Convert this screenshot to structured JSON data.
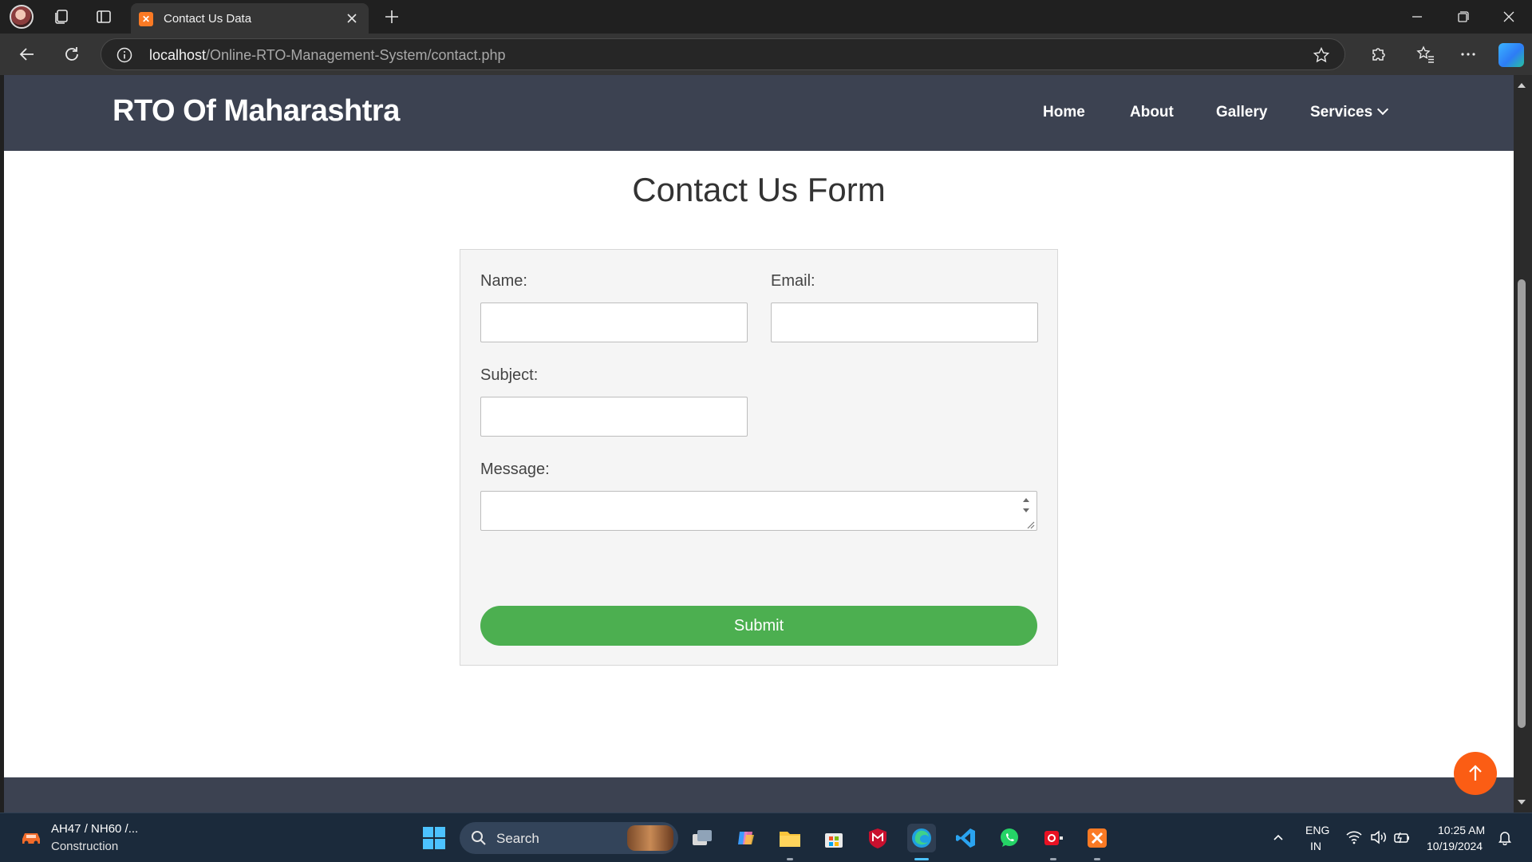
{
  "browser": {
    "tab_title": "Contact Us Data",
    "url_host": "localhost",
    "url_path": "/Online-RTO-Management-System/contact.php"
  },
  "site": {
    "brand": "RTO Of Maharashtra",
    "nav": {
      "home": "Home",
      "about": "About",
      "gallery": "Gallery",
      "services": "Services"
    }
  },
  "form": {
    "heading": "Contact Us Form",
    "name_label": "Name:",
    "email_label": "Email:",
    "subject_label": "Subject:",
    "message_label": "Message:",
    "name_value": "",
    "email_value": "",
    "subject_value": "",
    "message_value": "",
    "submit_label": "Submit"
  },
  "taskbar": {
    "weather_line1": "AH47 / NH60 /...",
    "weather_line2": "Construction",
    "search_placeholder": "Search",
    "lang_line1": "ENG",
    "lang_line2": "IN",
    "time": "10:25 AM",
    "date": "10/19/2024"
  },
  "colors": {
    "navbar": "#3c4251",
    "submit": "#4caf50",
    "back_to_top": "#fb5d14",
    "taskbar": "#1b2a3b"
  }
}
